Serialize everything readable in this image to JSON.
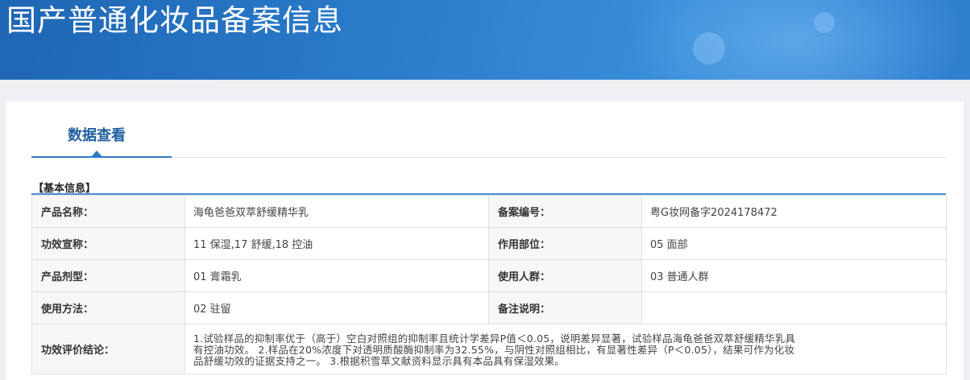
{
  "header": {
    "title": "国产普通化妆品备案信息"
  },
  "tabs": [
    {
      "label": "数据查看"
    }
  ],
  "section": {
    "title": "【基本信息】"
  },
  "fields": {
    "product_name": {
      "label": "产品名称：",
      "value": "海龟爸爸双萃舒缓精华乳"
    },
    "record_no": {
      "label": "备案编号：",
      "value": "粤G妆网备字2024178472"
    },
    "efficacy_claim": {
      "label": "功效宣称：",
      "value": "11 保湿,17 舒缓,18 控油"
    },
    "application_site": {
      "label": "作用部位：",
      "value": "05 面部"
    },
    "dosage_form": {
      "label": "产品剂型：",
      "value": "01 膏霜乳"
    },
    "target_group": {
      "label": "使用人群：",
      "value": "03 普通人群"
    },
    "usage_method": {
      "label": "使用方法：",
      "value": "02 驻留"
    },
    "remarks": {
      "label": "备注说明：",
      "value": ""
    },
    "efficacy_conclusion": {
      "label": "功效评价结论：",
      "value": "1.试验样品的抑制率优于（高于）空白对照组的抑制率且统计学差异P值＜0.05，说明差异显著，试验样品海龟爸爸双萃舒缓精华乳具有控油功效。 2.样品在20%浓度下对透明质酸酶抑制率为32.55%，与阴性对照组相比，有显著性差异（P＜0.05），结果可作为化妆品舒缓功效的证据支持之一。 3.根据积雪草文献资料显示具有本品具有保湿效果。"
    }
  }
}
